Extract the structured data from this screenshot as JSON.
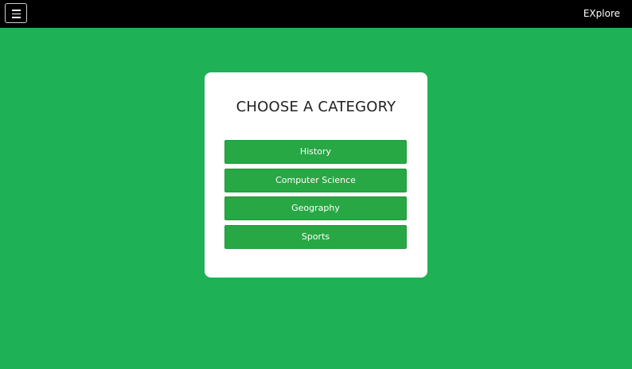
{
  "navbar": {
    "menu_icon": "hamburger-menu-icon",
    "brand": "EXplore",
    "background": "#000000"
  },
  "page": {
    "background": "#1fb155"
  },
  "card": {
    "title": "CHOOSE A CATEGORY",
    "categories": [
      {
        "label": "History"
      },
      {
        "label": "Computer Science"
      },
      {
        "label": "Geography"
      },
      {
        "label": "Sports"
      }
    ],
    "button_color": "#28a745"
  }
}
